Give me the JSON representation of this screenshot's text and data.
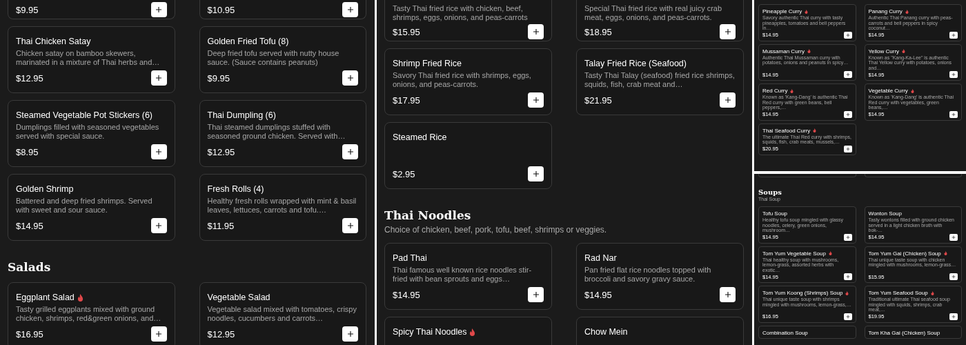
{
  "panels": [
    {
      "kind": "full",
      "blocks": [
        {
          "kind": "cards",
          "cards": [
            {
              "kind": "cut",
              "price": "$9.95"
            },
            {
              "kind": "cut",
              "price": "$10.95"
            },
            {
              "kind": "full",
              "name": "Thai Chicken Satay",
              "spicy": false,
              "description": "Chicken satay on bamboo skewers, marinated in a mixture of Thai herbs and…",
              "price": "$12.95"
            },
            {
              "kind": "full",
              "name": "Golden Fried Tofu (8)",
              "spicy": false,
              "description": "Deep fried tofu served with nutty house sauce. (Sauce contains peanuts)",
              "price": "$9.95"
            },
            {
              "kind": "full",
              "name": "Steamed Vegetable Pot Stickers (6)",
              "spicy": false,
              "description": "Dumplings filled with seasoned vegetables served with special sauce.",
              "price": "$8.95"
            },
            {
              "kind": "full",
              "name": "Thai Dumpling (6)",
              "spicy": false,
              "description": "Thai steamed dumplings stuffed with seasoned ground chicken. Served with…",
              "price": "$12.95"
            },
            {
              "kind": "full",
              "name": "Golden Shrimp",
              "spicy": false,
              "description": "Battered and deep fried shrimps. Served with sweet and sour sauce.",
              "price": "$14.95"
            },
            {
              "kind": "full",
              "name": "Fresh Rolls (4)",
              "spicy": false,
              "description": "Healthy fresh rolls wrapped with mint & basil leaves, lettuces, carrots and tofu.…",
              "price": "$11.95"
            }
          ]
        },
        {
          "kind": "section",
          "title": "Salads"
        },
        {
          "kind": "cards",
          "cards": [
            {
              "kind": "full",
              "name": "Eggplant Salad",
              "spicy": true,
              "description": "Tasty grilled eggplants mixed with ground chicken, shrimps, red&green onions, and…",
              "price": "$16.95"
            },
            {
              "kind": "full",
              "name": "Vegetable Salad",
              "spicy": false,
              "description": "Vegetable salad mixed with tomatoes, crispy noodles, cucumbers and carrots…",
              "price": "$12.95"
            }
          ]
        }
      ]
    },
    {
      "kind": "full",
      "blocks": [
        {
          "kind": "cards",
          "cards": [
            {
              "kind": "cut",
              "description": "Tasty Thai fried rice with chicken, beef, shrimps, eggs, onions, and peas-carrots",
              "price": "$15.95"
            },
            {
              "kind": "cut",
              "description": "Special Thai fried rice with real juicy crab meat, eggs, onions, and peas-carrots.",
              "price": "$18.95"
            },
            {
              "kind": "full",
              "name": "Shrimp Fried Rice",
              "spicy": false,
              "description": "Savory Thai fried rice with shrimps, eggs, onions, and peas-carrots.",
              "price": "$17.95"
            },
            {
              "kind": "full",
              "name": "Talay Fried Rice (Seafood)",
              "spicy": false,
              "description": "Tasty Thai Talay (seafood) fried rice shrimps, squids, fish, crab meat and…",
              "price": "$21.95"
            },
            {
              "kind": "full",
              "name": "Steamed Rice",
              "spicy": false,
              "price": "$2.95"
            }
          ]
        },
        {
          "kind": "section",
          "title": "Thai Noodles",
          "subtitle": "Choice of chicken, beef, pork, tofu, beef, shrimps or veggies."
        },
        {
          "kind": "cards",
          "cards": [
            {
              "kind": "full",
              "name": "Pad Thai",
              "spicy": false,
              "description": "Thai famous well known rice noodles stir-fried with bean sprouts and eggs…",
              "price": "$14.95"
            },
            {
              "kind": "full",
              "name": "Rad Nar",
              "spicy": false,
              "description": "Pan fried flat rice noodles topped with broccoli and savory gravy sauce.",
              "price": "$14.95"
            },
            {
              "kind": "full",
              "name": "Spicy Thai Noodles",
              "spicy": true
            },
            {
              "kind": "full",
              "name": "Chow Mein",
              "spicy": false
            }
          ]
        }
      ]
    },
    {
      "kind": "mini",
      "blocks": [
        {
          "kind": "cards",
          "cards": [
            {
              "kind": "full",
              "name": "Pineapple Curry",
              "spicy": true,
              "description": "Savory authentic Thai curry with tasty pineapples, tomatoes and bell peppers in…",
              "price": "$14.95"
            },
            {
              "kind": "full",
              "name": "Panang Curry",
              "spicy": true,
              "description": "Authentic Thai Panang curry with peas-carrots and bell peppers in spicy coconut…",
              "price": "$14.95"
            },
            {
              "kind": "full",
              "name": "Mussaman Curry",
              "spicy": true,
              "description": "Authentic Thai Mussaman curry with potatoes, onions and peanuts in spicy…",
              "price": "$14.95"
            },
            {
              "kind": "full",
              "name": "Yellow Curry",
              "spicy": true,
              "description": "Known as \"Kang-Ka-Lee\" is authentic Thai Yellow curry with potatoes, onions and…",
              "price": "$14.95"
            },
            {
              "kind": "full",
              "name": "Red Curry",
              "spicy": true,
              "description": "Known as 'Kang-Dang' is authentic Thai Red curry with green beans, bell peppers,…",
              "price": "$14.95"
            },
            {
              "kind": "full",
              "name": "Vegetable Curry",
              "spicy": true,
              "description": "Known as 'Kang-Dang' is authentic Thai Red curry with vegetables, green beans,…",
              "price": "$14.95"
            },
            {
              "kind": "full",
              "name": "Thai Seafood Curry",
              "spicy": true,
              "description": "The ultimate Thai Red curry with shrimps, squids, fish, crab meats, mussels,…",
              "price": "$20.95"
            }
          ]
        }
      ]
    },
    {
      "kind": "mini",
      "blocks": [
        {
          "kind": "cards",
          "cards": [
            {
              "kind": "stub"
            },
            {
              "kind": "stub"
            }
          ]
        },
        {
          "kind": "section",
          "title": "Soups",
          "subtitle": "Thai Soup"
        },
        {
          "kind": "cards",
          "cards": [
            {
              "kind": "full",
              "name": "Tofu Soup",
              "spicy": false,
              "description": "Healthy tofu soup mingled with glassy noodles, celery, green onions, mushroom…",
              "price": "$14.95"
            },
            {
              "kind": "full",
              "name": "Wonton Soup",
              "spicy": false,
              "description": "Tasty wontons filled with ground chicken served in a light chicken broth with bok-…",
              "price": "$14.95"
            },
            {
              "kind": "full",
              "name": "Tom Yum Vegetable Soup",
              "spicy": true,
              "description": "Thai healthy soup with mushrooms, lemon-grass, assorted herbs with exotic…",
              "price": "$14.95"
            },
            {
              "kind": "full",
              "name": "Tom Yum Gai (Chicken) Soup",
              "spicy": true,
              "description": "Thai unique taste soup with chicken mingled with mushrooms, lemon-grass…",
              "price": "$15.95"
            },
            {
              "kind": "full",
              "name": "Tom Yum Koong (Shrimps) Soup",
              "spicy": true,
              "description": "Thai unique taste soup with shrimps mingled with mushrooms, lemon-grass,…",
              "price": "$16.95"
            },
            {
              "kind": "full",
              "name": "Tom Yum Seafood Soup",
              "spicy": true,
              "description": "Traditional ultimate Thai seafood soup mingled with squids, shrimps, crab meat,…",
              "price": "$19.95"
            },
            {
              "kind": "full",
              "name": "Combination Soup",
              "spicy": false
            },
            {
              "kind": "full",
              "name": "Tom Kha Gai (Chicken) Soup",
              "spicy": false
            }
          ]
        }
      ]
    }
  ]
}
